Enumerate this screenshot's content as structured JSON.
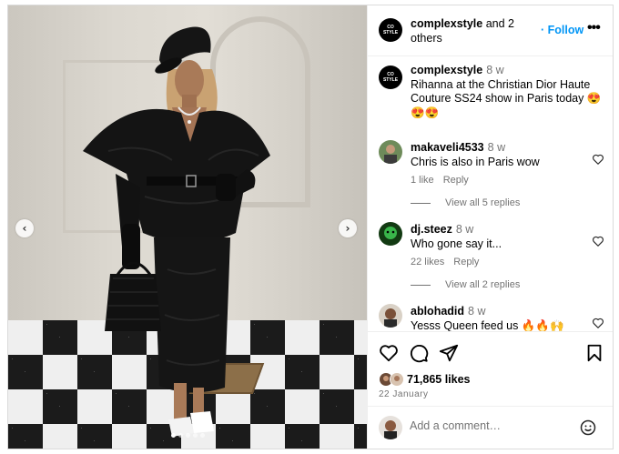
{
  "post": {
    "carousel": {
      "slide_count": 5,
      "active_index": 0
    }
  },
  "header": {
    "avatar_text_top": "CO",
    "avatar_text_bottom": "STYLE",
    "username": "complexstyle",
    "others": " and 2 others",
    "follow_label": "Follow",
    "more_icon": "more-horizontal-icon"
  },
  "caption": {
    "username": "complexstyle",
    "time": "8 w",
    "text": "Rihanna at the Christian Dior Haute Couture SS24 show in Paris today 😍😍😍"
  },
  "comments": [
    {
      "username": "makaveli4533",
      "time": "8 w",
      "text": "Chris is also in Paris wow",
      "likes": "1 like",
      "reply": "Reply",
      "view_replies": "View all 5 replies"
    },
    {
      "username": "dj.steez",
      "time": "8 w",
      "text": "Who gone say it...",
      "likes": "22 likes",
      "reply": "Reply",
      "view_replies": "View all 2 replies"
    },
    {
      "username": "ablohadid",
      "time": "8 w",
      "text": "Yesss Queen feed us 🔥🔥🙌"
    }
  ],
  "actions": {
    "icons": [
      "heart-icon",
      "comment-icon",
      "share-icon",
      "bookmark-icon"
    ],
    "likes": "71,865 likes",
    "date": "22 January"
  },
  "add_comment": {
    "placeholder": "Add a comment…"
  },
  "colors": {
    "link": "#0095f6",
    "muted": "#737373",
    "border": "#dbdbdb"
  }
}
